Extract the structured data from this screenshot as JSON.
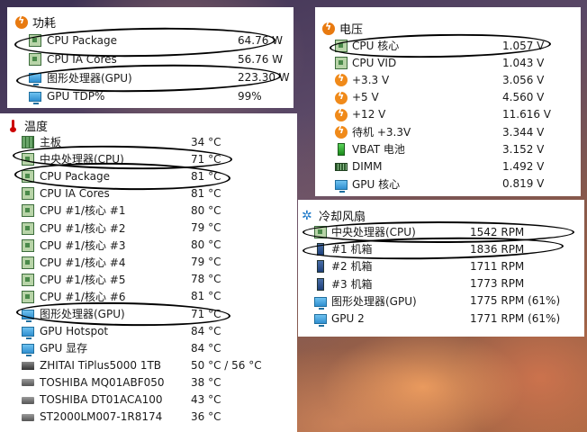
{
  "power_panel": {
    "title": "功耗",
    "rows": [
      {
        "label": "CPU Package",
        "value": "64.76 W",
        "icon": "cpu-chip-icon"
      },
      {
        "label": "CPU IA Cores",
        "value": "56.76 W",
        "icon": "cpu-chip-icon"
      },
      {
        "label": "图形处理器(GPU)",
        "value": "223.30 W",
        "icon": "gpu-monitor-icon"
      },
      {
        "label": "GPU TDP%",
        "value": "99%",
        "icon": "gpu-monitor-icon"
      }
    ]
  },
  "voltage_panel": {
    "title": "电压",
    "rows": [
      {
        "label": "CPU 核心",
        "value": "1.057 V",
        "icon": "cpu-chip-icon"
      },
      {
        "label": "CPU VID",
        "value": "1.043 V",
        "icon": "cpu-chip-icon"
      },
      {
        "label": "+3.3 V",
        "value": "3.056 V",
        "icon": "voltage-bolt-icon"
      },
      {
        "label": "+5 V",
        "value": "4.560 V",
        "icon": "voltage-bolt-icon"
      },
      {
        "label": "+12 V",
        "value": "11.616 V",
        "icon": "voltage-bolt-icon"
      },
      {
        "label": "待机 +3.3V",
        "value": "3.344 V",
        "icon": "voltage-bolt-icon"
      },
      {
        "label": "VBAT 电池",
        "value": "3.152 V",
        "icon": "battery-icon"
      },
      {
        "label": "DIMM",
        "value": "1.492 V",
        "icon": "memory-dimm-icon"
      },
      {
        "label": "GPU 核心",
        "value": "0.819 V",
        "icon": "gpu-monitor-icon"
      }
    ]
  },
  "temperature_panel": {
    "title": "温度",
    "rows": [
      {
        "label": "主板",
        "value": "34 °C",
        "icon": "motherboard-icon"
      },
      {
        "label": "中央处理器(CPU)",
        "value": "71 °C",
        "icon": "cpu-chip-icon"
      },
      {
        "label": "CPU Package",
        "value": "81 °C",
        "icon": "cpu-chip-icon"
      },
      {
        "label": "CPU IA Cores",
        "value": "81 °C",
        "icon": "cpu-chip-icon"
      },
      {
        "label": "CPU #1/核心 #1",
        "value": "80 °C",
        "icon": "cpu-chip-icon"
      },
      {
        "label": "CPU #1/核心 #2",
        "value": "79 °C",
        "icon": "cpu-chip-icon"
      },
      {
        "label": "CPU #1/核心 #3",
        "value": "80 °C",
        "icon": "cpu-chip-icon"
      },
      {
        "label": "CPU #1/核心 #4",
        "value": "79 °C",
        "icon": "cpu-chip-icon"
      },
      {
        "label": "CPU #1/核心 #5",
        "value": "78 °C",
        "icon": "cpu-chip-icon"
      },
      {
        "label": "CPU #1/核心 #6",
        "value": "81 °C",
        "icon": "cpu-chip-icon"
      },
      {
        "label": "图形处理器(GPU)",
        "value": "71 °C",
        "icon": "gpu-monitor-icon"
      },
      {
        "label": "GPU Hotspot",
        "value": "84 °C",
        "icon": "gpu-monitor-icon"
      },
      {
        "label": "GPU 显存",
        "value": "84 °C",
        "icon": "gpu-monitor-icon"
      },
      {
        "label": "ZHITAI TiPlus5000 1TB",
        "value": "50 °C / 56 °C",
        "icon": "ssd-drive-icon"
      },
      {
        "label": "TOSHIBA MQ01ABF050",
        "value": "38 °C",
        "icon": "hard-drive-icon"
      },
      {
        "label": "TOSHIBA DT01ACA100",
        "value": "43 °C",
        "icon": "hard-drive-icon"
      },
      {
        "label": "ST2000LM007-1R8174",
        "value": "36 °C",
        "icon": "hard-drive-icon"
      }
    ]
  },
  "fan_panel": {
    "title": "冷却风扇",
    "rows": [
      {
        "label": "中央处理器(CPU)",
        "value": "1542 RPM",
        "icon": "cpu-chip-icon"
      },
      {
        "label": "#1 机箱",
        "value": "1836 RPM",
        "icon": "case-fan-icon"
      },
      {
        "label": "#2 机箱",
        "value": "1711 RPM",
        "icon": "case-fan-icon"
      },
      {
        "label": "#3 机箱",
        "value": "1773 RPM",
        "icon": "case-fan-icon"
      },
      {
        "label": "图形处理器(GPU)",
        "value": "1775 RPM  (61%)",
        "icon": "gpu-monitor-icon"
      },
      {
        "label": "GPU 2",
        "value": "1771 RPM  (61%)",
        "icon": "gpu-monitor-icon"
      }
    ]
  }
}
